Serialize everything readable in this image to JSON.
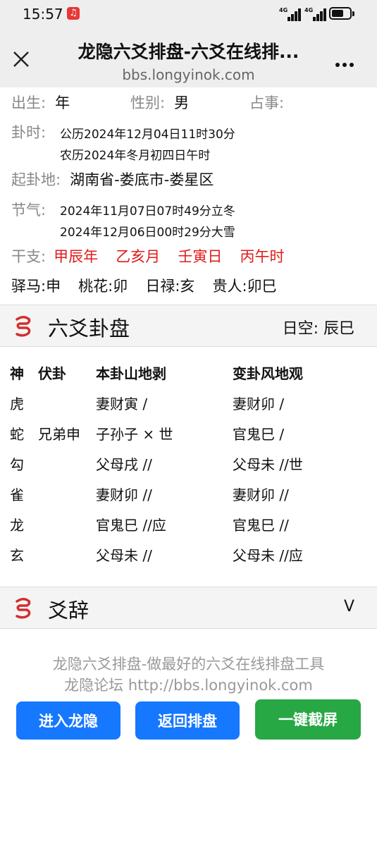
{
  "status_bar": {
    "time": "15:57",
    "signal_1": "4G",
    "signal_2": "4G"
  },
  "header": {
    "title": "龙隐六爻排盘-六爻在线排...",
    "url": "bbs.longyinok.com"
  },
  "info": {
    "birth_label": "出生:",
    "birth_value": "年",
    "gender_label": "性别:",
    "gender_value": "男",
    "matter_label": "占事:",
    "matter_value": "",
    "time_label": "卦时:",
    "solar": "公历2024年12月04日11时30分",
    "lunar": "农历2024年冬月初四日午时",
    "place_label": "起卦地:",
    "place_value": "湖南省-娄底市-娄星区",
    "solar_term_label": "节气:",
    "term_1": "2024年11月07日07时49分立冬",
    "term_2": "2024年12月06日00时29分大雪",
    "ganzhi_label": "干支:",
    "ganzhi": [
      "甲辰年",
      "乙亥月",
      "壬寅日",
      "丙午时"
    ],
    "shensha": [
      "驿马:申",
      "桃花:卯",
      "日禄:亥",
      "贵人:卯巳"
    ]
  },
  "gua_section": {
    "title": "六爻卦盘",
    "kong": "日空: 辰巳",
    "headers": {
      "shen": "神",
      "fu": "伏卦",
      "ben": "本卦山地剥",
      "bian": "变卦风地观"
    },
    "rows": [
      {
        "shen": "虎",
        "fu": "",
        "ben": "妻财寅 /",
        "bian": "妻财卯 /"
      },
      {
        "shen": "蛇",
        "fu": "兄弟申",
        "ben": "子孙子 × 世",
        "bian": "官鬼巳 /"
      },
      {
        "shen": "勾",
        "fu": "",
        "ben": "父母戌 //",
        "bian": "父母未 //世"
      },
      {
        "shen": "雀",
        "fu": "",
        "ben": "妻财卯 //",
        "bian": "妻财卯 //"
      },
      {
        "shen": "龙",
        "fu": "",
        "ben": "官鬼巳 //应",
        "bian": "官鬼巳 //"
      },
      {
        "shen": "玄",
        "fu": "",
        "ben": "父母未 //",
        "bian": "父母未 //应"
      }
    ]
  },
  "yaoci_section": {
    "title": "爻辞",
    "toggle": "V"
  },
  "footer": {
    "line_1": "龙隐六爻排盘-做最好的六爻在线排盘工具",
    "line_2": "龙隐论坛 http://bbs.longyinok.com",
    "buttons": [
      "进入龙隐",
      "返回排盘",
      "一键截屏"
    ]
  },
  "colors": {
    "blue_button": "#1677ff",
    "green_button": "#28a745",
    "red_text": "#e01b1b"
  }
}
